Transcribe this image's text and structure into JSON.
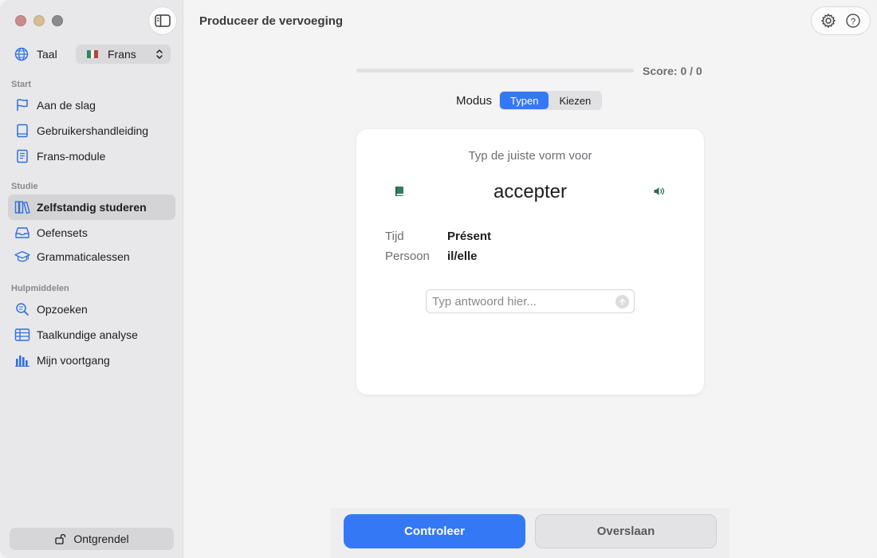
{
  "sidebar": {
    "language_label": "Taal",
    "language_value": "Frans",
    "sections": {
      "start": "Start",
      "studie": "Studie",
      "hulp": "Hulpmiddelen"
    },
    "items": [
      {
        "label": "Aan de slag",
        "icon": "flag-icon"
      },
      {
        "label": "Gebruikershandleiding",
        "icon": "book-icon"
      },
      {
        "label": "Frans-module",
        "icon": "document-icon"
      },
      {
        "label": "Zelfstandig studeren",
        "icon": "books-icon",
        "active": true
      },
      {
        "label": "Oefensets",
        "icon": "tray-icon"
      },
      {
        "label": "Grammaticalessen",
        "icon": "graduation-cap-icon"
      },
      {
        "label": "Opzoeken",
        "icon": "magnifier-icon"
      },
      {
        "label": "Taalkundige analyse",
        "icon": "table-icon"
      },
      {
        "label": "Mijn voortgang",
        "icon": "bar-chart-icon"
      }
    ],
    "unlock_label": "Ontgrendel"
  },
  "header": {
    "title": "Produceer de vervoeging"
  },
  "exercise": {
    "progress": 0,
    "score": "Score: 0 / 0",
    "mode_label": "Modus",
    "modes": [
      "Typen",
      "Kiezen"
    ],
    "active_mode": "Typen",
    "prompt": "Typ de juiste vorm voor",
    "verb": "accepter",
    "tense_label": "Tijd",
    "tense_value": "Présent",
    "person_label": "Persoon",
    "person_value": "il/elle",
    "answer_placeholder": "Typ antwoord hier..."
  },
  "actions": {
    "check": "Controleer",
    "skip": "Overslaan"
  },
  "colors": {
    "accent": "#3478f6",
    "sidebar_icon": "#2f6fde"
  }
}
